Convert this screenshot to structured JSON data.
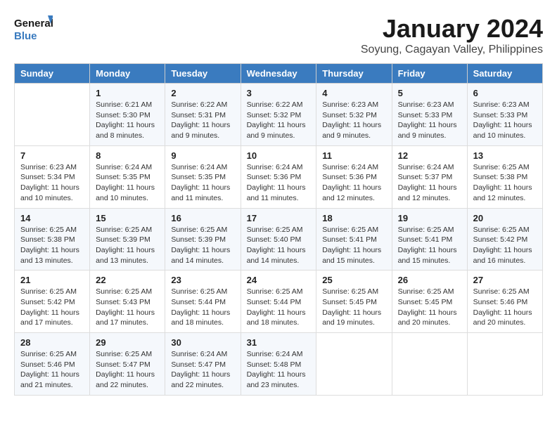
{
  "logo": {
    "line1": "General",
    "line2": "Blue"
  },
  "title": "January 2024",
  "location": "Soyung, Cagayan Valley, Philippines",
  "days_of_week": [
    "Sunday",
    "Monday",
    "Tuesday",
    "Wednesday",
    "Thursday",
    "Friday",
    "Saturday"
  ],
  "weeks": [
    [
      {
        "day": "",
        "info": ""
      },
      {
        "day": "1",
        "info": "Sunrise: 6:21 AM\nSunset: 5:30 PM\nDaylight: 11 hours\nand 8 minutes."
      },
      {
        "day": "2",
        "info": "Sunrise: 6:22 AM\nSunset: 5:31 PM\nDaylight: 11 hours\nand 9 minutes."
      },
      {
        "day": "3",
        "info": "Sunrise: 6:22 AM\nSunset: 5:32 PM\nDaylight: 11 hours\nand 9 minutes."
      },
      {
        "day": "4",
        "info": "Sunrise: 6:23 AM\nSunset: 5:32 PM\nDaylight: 11 hours\nand 9 minutes."
      },
      {
        "day": "5",
        "info": "Sunrise: 6:23 AM\nSunset: 5:33 PM\nDaylight: 11 hours\nand 9 minutes."
      },
      {
        "day": "6",
        "info": "Sunrise: 6:23 AM\nSunset: 5:33 PM\nDaylight: 11 hours\nand 10 minutes."
      }
    ],
    [
      {
        "day": "7",
        "info": "Sunrise: 6:23 AM\nSunset: 5:34 PM\nDaylight: 11 hours\nand 10 minutes."
      },
      {
        "day": "8",
        "info": "Sunrise: 6:24 AM\nSunset: 5:35 PM\nDaylight: 11 hours\nand 10 minutes."
      },
      {
        "day": "9",
        "info": "Sunrise: 6:24 AM\nSunset: 5:35 PM\nDaylight: 11 hours\nand 11 minutes."
      },
      {
        "day": "10",
        "info": "Sunrise: 6:24 AM\nSunset: 5:36 PM\nDaylight: 11 hours\nand 11 minutes."
      },
      {
        "day": "11",
        "info": "Sunrise: 6:24 AM\nSunset: 5:36 PM\nDaylight: 11 hours\nand 12 minutes."
      },
      {
        "day": "12",
        "info": "Sunrise: 6:24 AM\nSunset: 5:37 PM\nDaylight: 11 hours\nand 12 minutes."
      },
      {
        "day": "13",
        "info": "Sunrise: 6:25 AM\nSunset: 5:38 PM\nDaylight: 11 hours\nand 12 minutes."
      }
    ],
    [
      {
        "day": "14",
        "info": "Sunrise: 6:25 AM\nSunset: 5:38 PM\nDaylight: 11 hours\nand 13 minutes."
      },
      {
        "day": "15",
        "info": "Sunrise: 6:25 AM\nSunset: 5:39 PM\nDaylight: 11 hours\nand 13 minutes."
      },
      {
        "day": "16",
        "info": "Sunrise: 6:25 AM\nSunset: 5:39 PM\nDaylight: 11 hours\nand 14 minutes."
      },
      {
        "day": "17",
        "info": "Sunrise: 6:25 AM\nSunset: 5:40 PM\nDaylight: 11 hours\nand 14 minutes."
      },
      {
        "day": "18",
        "info": "Sunrise: 6:25 AM\nSunset: 5:41 PM\nDaylight: 11 hours\nand 15 minutes."
      },
      {
        "day": "19",
        "info": "Sunrise: 6:25 AM\nSunset: 5:41 PM\nDaylight: 11 hours\nand 15 minutes."
      },
      {
        "day": "20",
        "info": "Sunrise: 6:25 AM\nSunset: 5:42 PM\nDaylight: 11 hours\nand 16 minutes."
      }
    ],
    [
      {
        "day": "21",
        "info": "Sunrise: 6:25 AM\nSunset: 5:42 PM\nDaylight: 11 hours\nand 17 minutes."
      },
      {
        "day": "22",
        "info": "Sunrise: 6:25 AM\nSunset: 5:43 PM\nDaylight: 11 hours\nand 17 minutes."
      },
      {
        "day": "23",
        "info": "Sunrise: 6:25 AM\nSunset: 5:44 PM\nDaylight: 11 hours\nand 18 minutes."
      },
      {
        "day": "24",
        "info": "Sunrise: 6:25 AM\nSunset: 5:44 PM\nDaylight: 11 hours\nand 18 minutes."
      },
      {
        "day": "25",
        "info": "Sunrise: 6:25 AM\nSunset: 5:45 PM\nDaylight: 11 hours\nand 19 minutes."
      },
      {
        "day": "26",
        "info": "Sunrise: 6:25 AM\nSunset: 5:45 PM\nDaylight: 11 hours\nand 20 minutes."
      },
      {
        "day": "27",
        "info": "Sunrise: 6:25 AM\nSunset: 5:46 PM\nDaylight: 11 hours\nand 20 minutes."
      }
    ],
    [
      {
        "day": "28",
        "info": "Sunrise: 6:25 AM\nSunset: 5:46 PM\nDaylight: 11 hours\nand 21 minutes."
      },
      {
        "day": "29",
        "info": "Sunrise: 6:25 AM\nSunset: 5:47 PM\nDaylight: 11 hours\nand 22 minutes."
      },
      {
        "day": "30",
        "info": "Sunrise: 6:24 AM\nSunset: 5:47 PM\nDaylight: 11 hours\nand 22 minutes."
      },
      {
        "day": "31",
        "info": "Sunrise: 6:24 AM\nSunset: 5:48 PM\nDaylight: 11 hours\nand 23 minutes."
      },
      {
        "day": "",
        "info": ""
      },
      {
        "day": "",
        "info": ""
      },
      {
        "day": "",
        "info": ""
      }
    ]
  ]
}
